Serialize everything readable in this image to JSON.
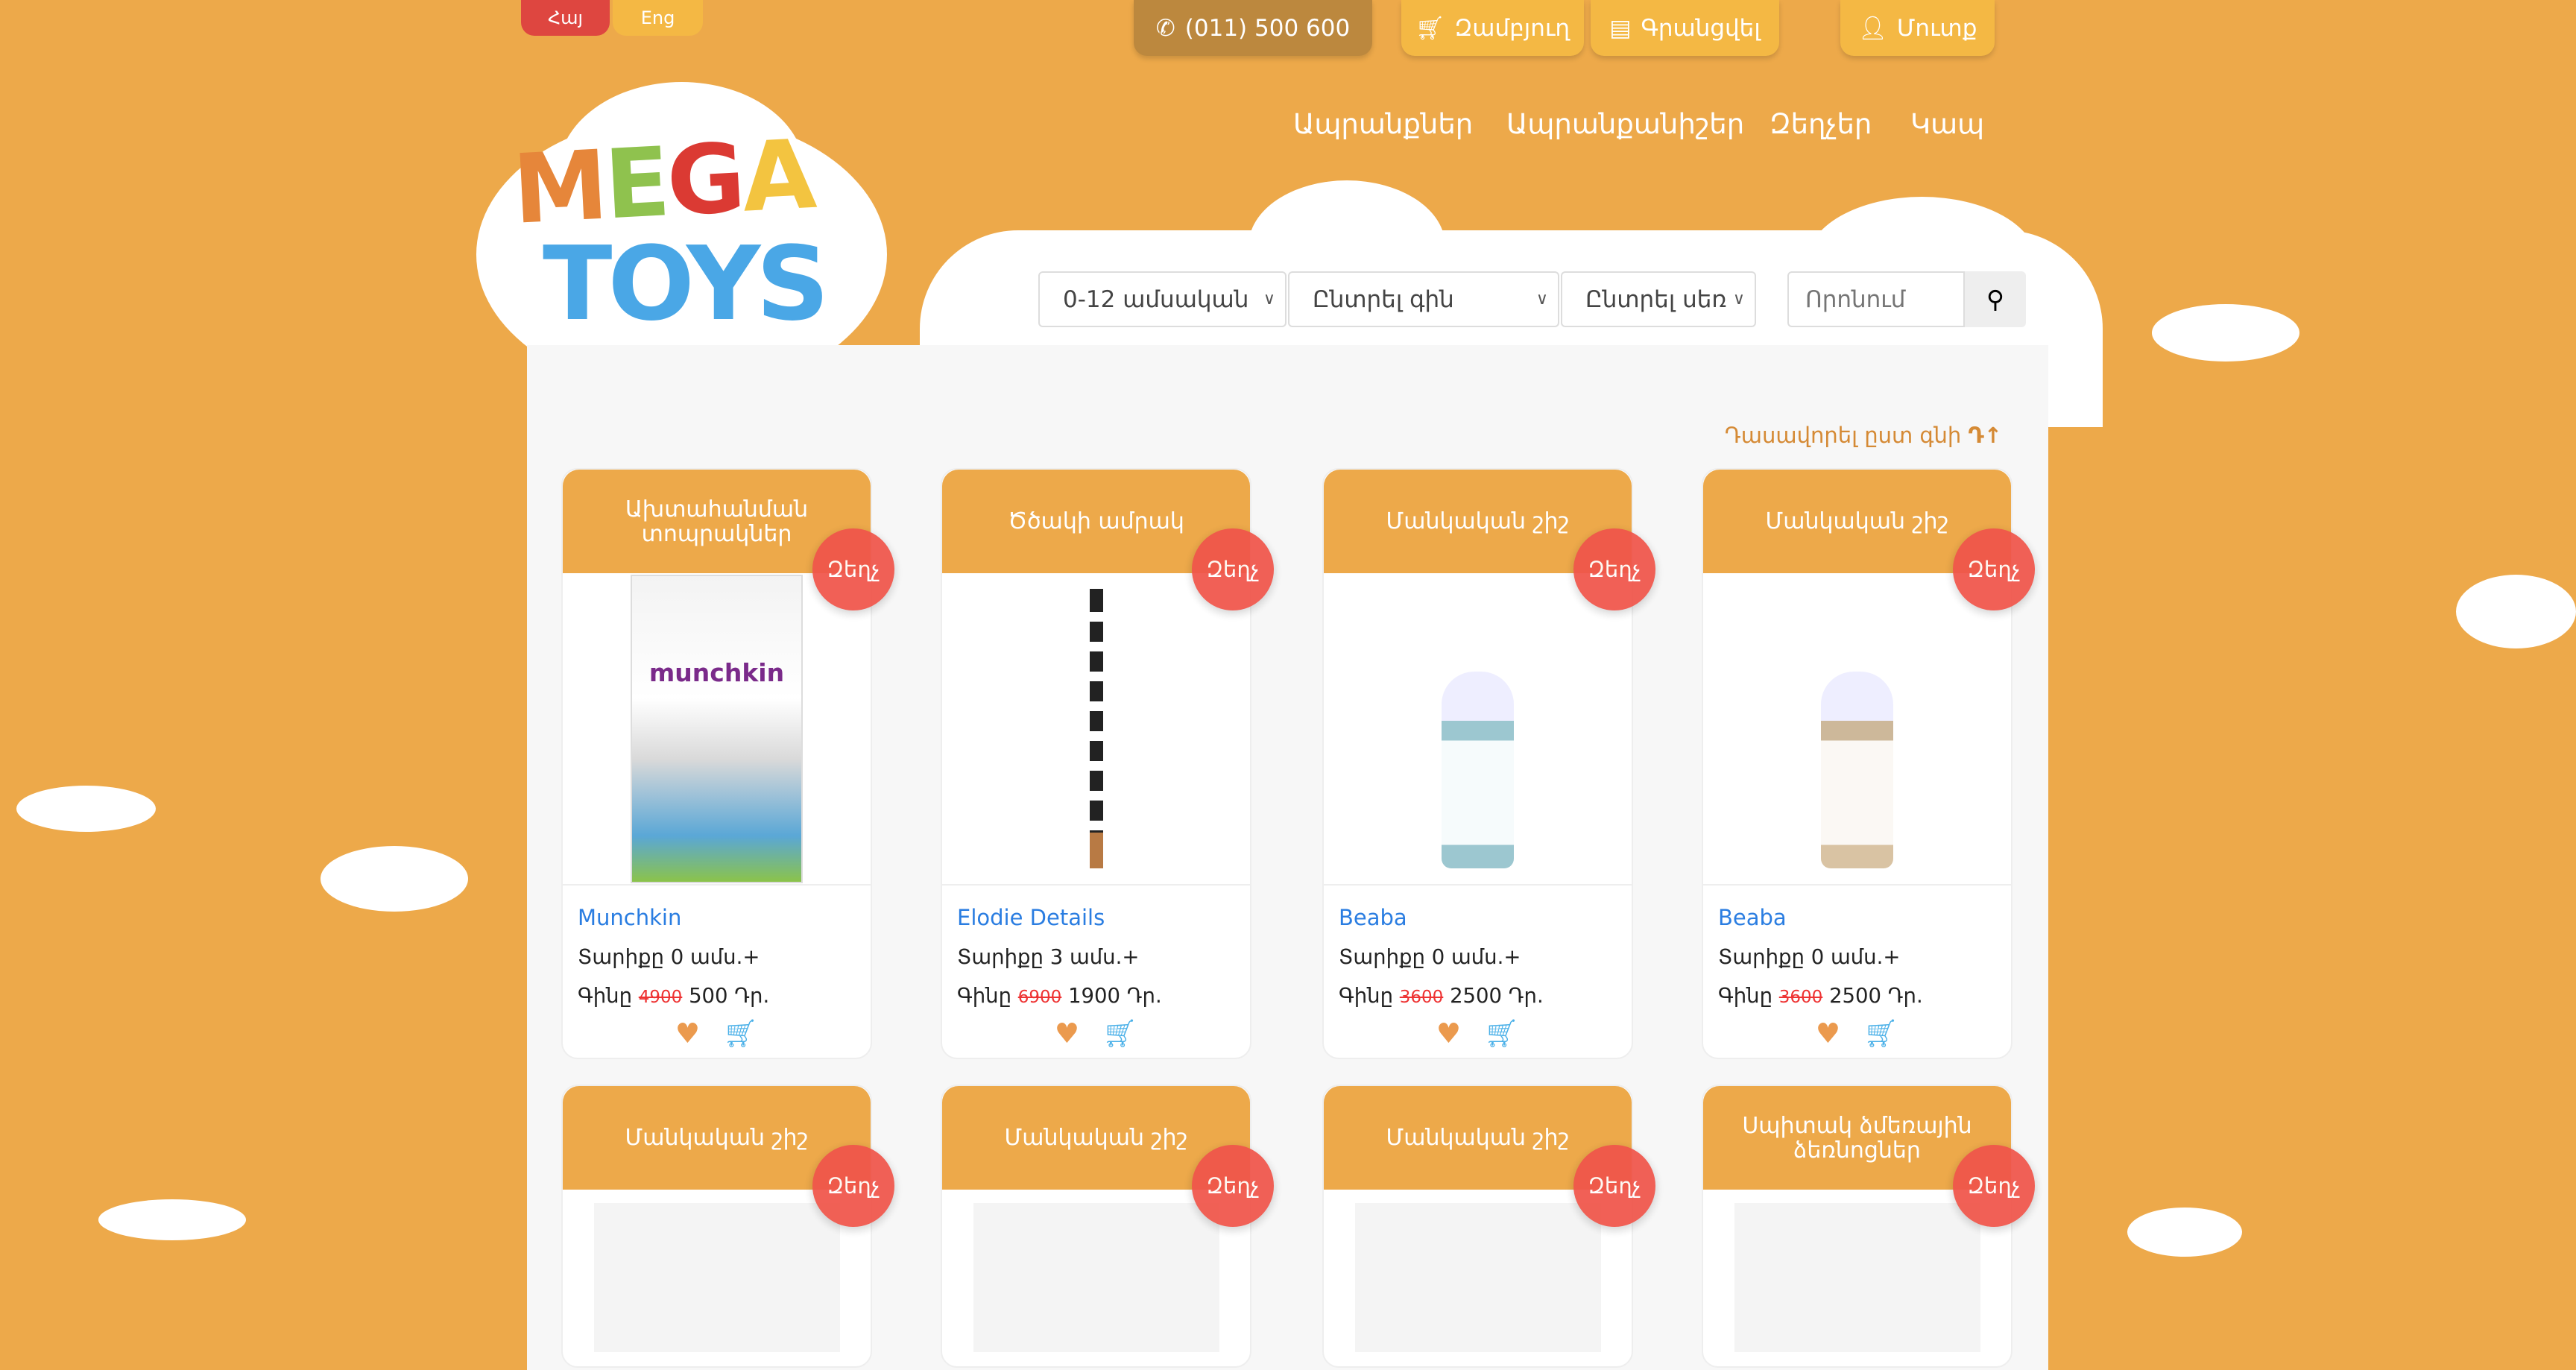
{
  "lang": {
    "hy": "Հայ",
    "en": "Eng"
  },
  "top": {
    "phone": "(011) 500 600",
    "cart": "Զամբյուղ",
    "register": "Գրանցվել",
    "login": "Մուտք"
  },
  "nav": [
    "Ապրանքներ",
    "Ապրանքանիշեր",
    "Զեղչեր",
    "Կապ"
  ],
  "logo": {
    "line1": "MEGA",
    "line2": "TOYS"
  },
  "filters": {
    "age": "0-12 ամսական",
    "price": "Ընտրել գին",
    "gender": "Ընտրել սեռ",
    "search_placeholder": "Որոնում"
  },
  "sort_label": "Դասավորել ըստ գնի",
  "badge": "Զեղչ",
  "products": [
    {
      "title": "Ախտահանման տոպրակներ",
      "brand": "Munchkin",
      "age": "Տարիքը 0 ամս.+",
      "price_label": "Գինը",
      "old": "4900",
      "new": "500 Դր."
    },
    {
      "title": "Ծծակի ամրակ",
      "brand": "Elodie Details",
      "age": "Տարիքը 3 ամս.+",
      "price_label": "Գինը",
      "old": "6900",
      "new": "1900 Դր."
    },
    {
      "title": "Մանկական շիշ",
      "brand": "Beaba",
      "age": "Տարիքը 0 ամս.+",
      "price_label": "Գինը",
      "old": "3600",
      "new": "2500 Դր."
    },
    {
      "title": "Մանկական շիշ",
      "brand": "Beaba",
      "age": "Տարիքը 0 ամս.+",
      "price_label": "Գինը",
      "old": "3600",
      "new": "2500 Դր."
    },
    {
      "title": "Մանկական շիշ"
    },
    {
      "title": "Մանկական շիշ"
    },
    {
      "title": "Մանկական շիշ"
    },
    {
      "title": "Սպիտակ ձմեռային ձեռնոցներ"
    }
  ],
  "colors": {
    "bg": "#EDA94A",
    "badge": "#F0554A",
    "link": "#2a7de1"
  }
}
